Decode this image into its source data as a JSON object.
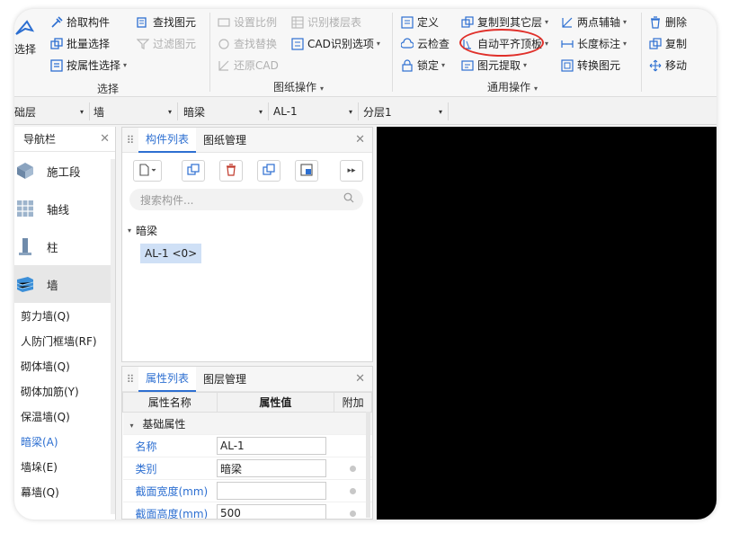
{
  "ribbon": {
    "select": {
      "label": "选择",
      "group": "选择"
    },
    "col1": [
      {
        "icon": "pick-component-icon",
        "label": "拾取构件"
      },
      {
        "icon": "batch-select-icon",
        "label": "批量选择"
      },
      {
        "icon": "select-by-attr-icon",
        "label": "按属性选择"
      }
    ],
    "col2": [
      {
        "icon": "find-element-icon",
        "label": "查找图元"
      },
      {
        "icon": "filter-element-icon",
        "label": "过滤图元"
      }
    ],
    "drawing_group": {
      "label": "图纸操作",
      "items": [
        {
          "icon": "set-scale-icon",
          "label": "设置比例"
        },
        {
          "icon": "find-replace-icon",
          "label": "查找替换"
        },
        {
          "icon": "restore-cad-icon",
          "label": "还原CAD"
        },
        {
          "icon": "identify-floor-table-icon",
          "label": "识别楼层表"
        },
        {
          "icon": "cad-identify-options-icon",
          "label": "CAD识别选项"
        }
      ]
    },
    "common_group": {
      "label": "通用操作",
      "items": [
        {
          "icon": "define-icon",
          "label": "定义"
        },
        {
          "icon": "cloud-check-icon",
          "label": "云检查"
        },
        {
          "icon": "lock-icon",
          "label": "锁定"
        },
        {
          "icon": "copy-to-other-layer-icon",
          "label": "复制到其它层"
        },
        {
          "icon": "auto-align-top-icon",
          "label": "自动平齐顶板"
        },
        {
          "icon": "element-extract-icon",
          "label": "图元提取"
        },
        {
          "icon": "two-point-axis-icon",
          "label": "两点辅轴"
        },
        {
          "icon": "length-dimension-icon",
          "label": "长度标注"
        },
        {
          "icon": "convert-element-icon",
          "label": "转换图元"
        }
      ]
    },
    "edit_group": [
      {
        "icon": "delete-icon",
        "label": "删除"
      },
      {
        "icon": "copy-icon",
        "label": "复制"
      },
      {
        "icon": "move-icon",
        "label": "移动"
      }
    ]
  },
  "dropbar": [
    {
      "value": "础层"
    },
    {
      "value": "墙"
    },
    {
      "value": "暗梁"
    },
    {
      "value": "AL-1"
    },
    {
      "value": "分层1"
    }
  ],
  "nav": {
    "title": "导航栏",
    "categories": [
      {
        "icon": "construction-section-icon",
        "label": "施工段"
      },
      {
        "icon": "axis-grid-icon",
        "label": "轴线"
      },
      {
        "icon": "column-icon",
        "label": "柱"
      },
      {
        "icon": "wall-icon",
        "label": "墙"
      }
    ],
    "sub_items": [
      {
        "label": "剪力墙(Q)"
      },
      {
        "label": "人防门框墙(RF)"
      },
      {
        "label": "砌体墙(Q)"
      },
      {
        "label": "砌体加筋(Y)"
      },
      {
        "label": "保温墙(Q)"
      },
      {
        "label": "暗梁(A)"
      },
      {
        "label": "墙垛(E)"
      },
      {
        "label": "幕墙(Q)"
      }
    ],
    "active_sub": "暗梁(A)"
  },
  "component_panel": {
    "tabs": [
      "构件列表",
      "图纸管理"
    ],
    "search_placeholder": "搜索构件...",
    "tree_root": "暗梁",
    "tree_item": "AL-1 <0>"
  },
  "props_panel": {
    "tabs": [
      "属性列表",
      "图层管理"
    ],
    "headers": [
      "属性名称",
      "属性值",
      "附加"
    ],
    "group": "基础属性",
    "rows": [
      {
        "name": "名称",
        "value": "AL-1",
        "extra": false
      },
      {
        "name": "类别",
        "value": "暗梁",
        "extra": true
      },
      {
        "name": "截面宽度(mm)",
        "value": "",
        "extra": true
      },
      {
        "name": "截面高度(mm)",
        "value": "500",
        "extra": true
      }
    ]
  },
  "colors": {
    "accent": "#2d6fd1",
    "highlight_circle": "#e0302a",
    "canvas": "#000000",
    "selected_item_bg": "#cfe0f6"
  }
}
